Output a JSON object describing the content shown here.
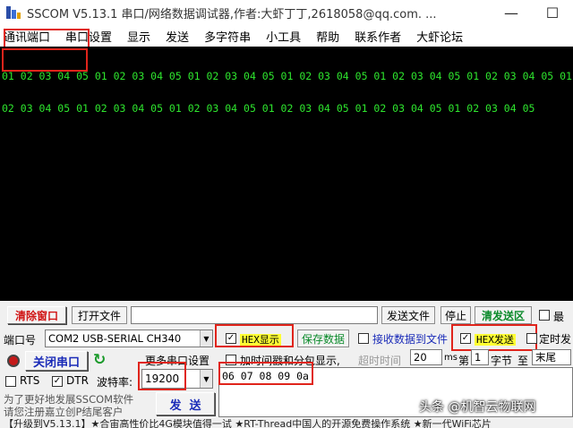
{
  "window": {
    "title": "SSCOM V5.13.1 串口/网络数据调试器,作者:大虾丁丁,2618058@qq.com. ...",
    "minimize": "—",
    "maximize": "☐"
  },
  "menu": [
    "通讯端口",
    "串口设置",
    "显示",
    "发送",
    "多字符串",
    "小工具",
    "帮助",
    "联系作者",
    "大虾论坛"
  ],
  "console": {
    "lines": [
      "01 02 03 04 05 01 02 03 04 05 01 02 03 04 05 01 02 03 04 05 01 02 03 04 05 01 02 03 04 05 01",
      "02 03 04 05 01 02 03 04 05 01 02 03 04 05 01 02 03 04 05 01 02 03 04 05 01 02 03 04 05"
    ]
  },
  "toolbar_row": {
    "clear_window": "清除窗口",
    "open_file": "打开文件",
    "send_file": "发送文件",
    "stop": "停止",
    "clear_send": "清发送区",
    "last": "最"
  },
  "port_row": {
    "port_label": "端口号",
    "port_value": "COM2 USB-SERIAL CH340",
    "hex_display": "HEX显示",
    "save_data": "保存数据",
    "recv_to_file": "接收数据到文件",
    "hex_send": "HEX发送",
    "timed_send": "定时发"
  },
  "control_row": {
    "close_port": "关闭串口",
    "more_settings": "更多串口设置",
    "add_timestamp": "加时间戳和分包显示,",
    "timeout_label": "超时时间",
    "timeout_value": "20",
    "ms_label": "ms",
    "nth_label": "第",
    "byte_value": "1",
    "byte_label": "字节",
    "to_label": "至",
    "end_value": "末尾"
  },
  "signal_row": {
    "rts": "RTS",
    "dtr": "DTR",
    "baud_label": "波特率:",
    "baud_value": "19200",
    "send_input": "06 07 08 09 0a"
  },
  "bottom": {
    "promo_line1": "为了更好地发展SSCOM软件",
    "promo_line2": "请您注册嘉立创P结尾客户",
    "send_button": "发  送",
    "watermark": "头条 @机智云物联网"
  },
  "status_bar": "【升级到V5.13.1】★合宙高性价比4G模块值得一试 ★RT-Thread中国人的开源免费操作系统 ★新一代WiFi芯片"
}
